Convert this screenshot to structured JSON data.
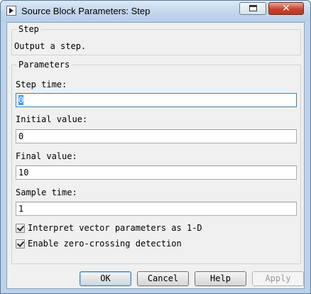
{
  "window": {
    "title": "Source Block Parameters: Step",
    "close_glyph": "✕"
  },
  "step_group": {
    "legend": "Step",
    "description": "Output a step."
  },
  "params_group": {
    "legend": "Parameters",
    "fields": [
      {
        "label": "Step time:",
        "value": "0"
      },
      {
        "label": "Initial value:",
        "value": "0"
      },
      {
        "label": "Final value:",
        "value": "10"
      },
      {
        "label": "Sample time:",
        "value": "1"
      }
    ],
    "checkboxes": [
      {
        "label": "Interpret vector parameters as 1-D",
        "checked": true
      },
      {
        "label": "Enable zero-crossing detection",
        "checked": true
      }
    ]
  },
  "buttons": {
    "ok": "OK",
    "cancel": "Cancel",
    "help": "Help",
    "apply": "Apply"
  }
}
